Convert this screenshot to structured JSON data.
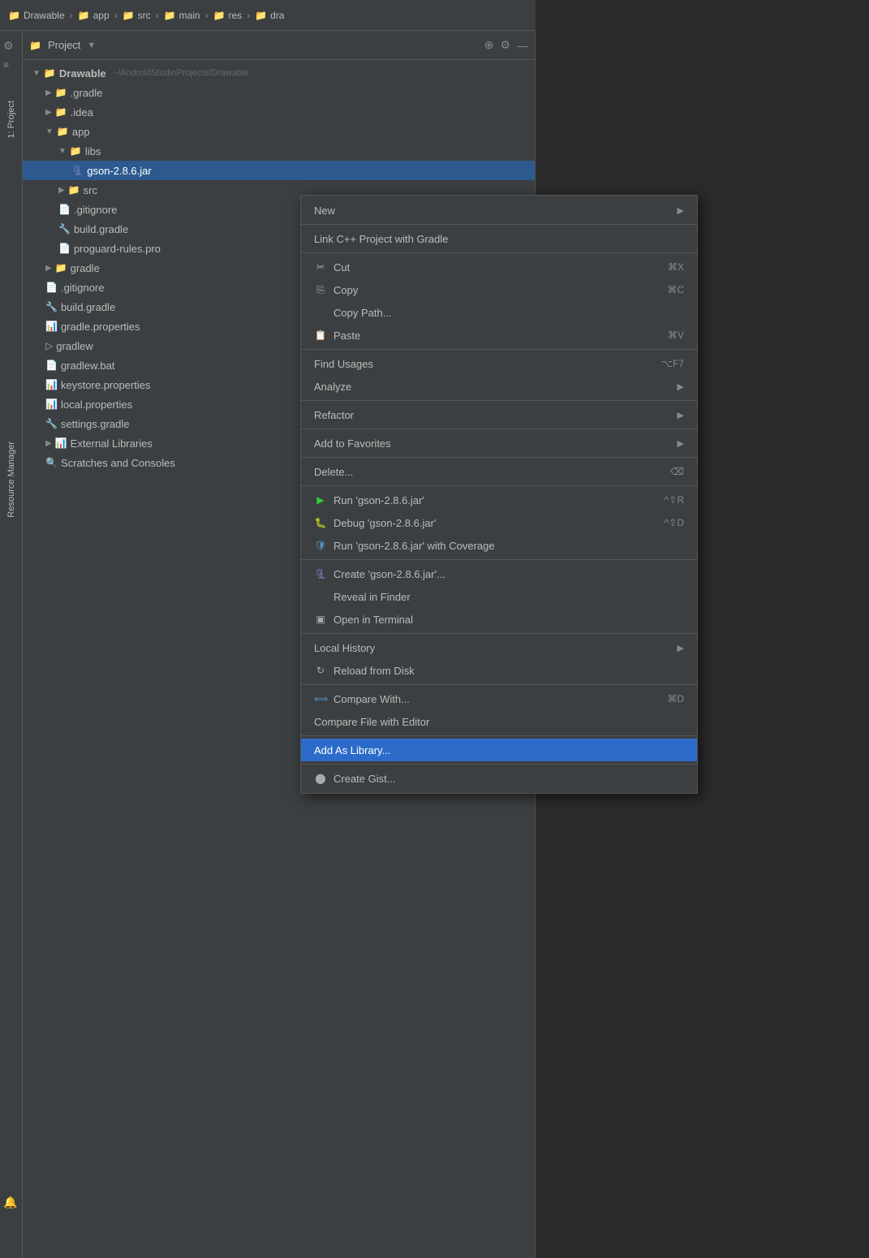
{
  "breadcrumb": {
    "items": [
      "Drawable",
      "app",
      "src",
      "main",
      "res",
      "dra"
    ]
  },
  "panel": {
    "title": "Project",
    "project_root": "Drawable",
    "project_path": "~/AndroidStudioProjects/Drawable",
    "tree": [
      {
        "label": ".gradle",
        "indent": 1,
        "type": "folder",
        "expanded": false
      },
      {
        "label": ".idea",
        "indent": 1,
        "type": "folder",
        "expanded": false
      },
      {
        "label": "app",
        "indent": 1,
        "type": "folder",
        "expanded": true
      },
      {
        "label": "libs",
        "indent": 2,
        "type": "folder",
        "expanded": true
      },
      {
        "label": "gson-2.8.6.jar",
        "indent": 3,
        "type": "jar",
        "selected": true
      },
      {
        "label": "src",
        "indent": 2,
        "type": "folder",
        "expanded": false
      },
      {
        "label": ".gitignore",
        "indent": 2,
        "type": "file"
      },
      {
        "label": "build.gradle",
        "indent": 2,
        "type": "gradle"
      },
      {
        "label": "proguard-rules.pro",
        "indent": 2,
        "type": "file"
      },
      {
        "label": "gradle",
        "indent": 1,
        "type": "folder",
        "expanded": false
      },
      {
        "label": ".gitignore",
        "indent": 1,
        "type": "file"
      },
      {
        "label": "build.gradle",
        "indent": 1,
        "type": "gradle"
      },
      {
        "label": "gradle.properties",
        "indent": 1,
        "type": "properties"
      },
      {
        "label": "gradlew",
        "indent": 1,
        "type": "file"
      },
      {
        "label": "gradlew.bat",
        "indent": 1,
        "type": "file"
      },
      {
        "label": "keystore.properties",
        "indent": 1,
        "type": "properties"
      },
      {
        "label": "local.properties",
        "indent": 1,
        "type": "properties"
      },
      {
        "label": "settings.gradle",
        "indent": 1,
        "type": "gradle"
      },
      {
        "label": "External Libraries",
        "indent": 1,
        "type": "folder",
        "expanded": false
      },
      {
        "label": "Scratches and Consoles",
        "indent": 1,
        "type": "scratches"
      }
    ]
  },
  "context_menu": {
    "items": [
      {
        "id": "new",
        "label": "New",
        "has_arrow": true,
        "type": "normal"
      },
      {
        "id": "sep1",
        "type": "separator"
      },
      {
        "id": "link-cpp",
        "label": "Link C++ Project with Gradle",
        "type": "normal"
      },
      {
        "id": "sep2",
        "type": "separator"
      },
      {
        "id": "cut",
        "label": "Cut",
        "shortcut": "⌘X",
        "icon": "✂",
        "type": "normal"
      },
      {
        "id": "copy",
        "label": "Copy",
        "shortcut": "⌘C",
        "icon": "⎘",
        "type": "normal"
      },
      {
        "id": "copy-path",
        "label": "Copy Path...",
        "type": "normal"
      },
      {
        "id": "paste",
        "label": "Paste",
        "shortcut": "⌘V",
        "icon": "📋",
        "type": "normal"
      },
      {
        "id": "sep3",
        "type": "separator"
      },
      {
        "id": "find-usages",
        "label": "Find Usages",
        "shortcut": "⌥F7",
        "type": "normal"
      },
      {
        "id": "analyze",
        "label": "Analyze",
        "has_arrow": true,
        "type": "normal"
      },
      {
        "id": "sep4",
        "type": "separator"
      },
      {
        "id": "refactor",
        "label": "Refactor",
        "has_arrow": true,
        "type": "normal"
      },
      {
        "id": "sep5",
        "type": "separator"
      },
      {
        "id": "add-favorites",
        "label": "Add to Favorites",
        "has_arrow": true,
        "type": "normal"
      },
      {
        "id": "sep6",
        "type": "separator"
      },
      {
        "id": "delete",
        "label": "Delete...",
        "shortcut": "⌫",
        "type": "normal"
      },
      {
        "id": "sep7",
        "type": "separator"
      },
      {
        "id": "run",
        "label": "Run 'gson-2.8.6.jar'",
        "shortcut": "^⇧R",
        "icon_type": "run",
        "type": "normal"
      },
      {
        "id": "debug",
        "label": "Debug 'gson-2.8.6.jar'",
        "shortcut": "^⇧D",
        "icon_type": "debug",
        "type": "normal"
      },
      {
        "id": "coverage",
        "label": "Run 'gson-2.8.6.jar' with Coverage",
        "icon_type": "coverage",
        "type": "normal"
      },
      {
        "id": "sep8",
        "type": "separator"
      },
      {
        "id": "create",
        "label": "Create 'gson-2.8.6.jar'...",
        "icon_type": "create",
        "type": "normal"
      },
      {
        "id": "reveal",
        "label": "Reveal in Finder",
        "type": "normal"
      },
      {
        "id": "terminal",
        "label": "Open in Terminal",
        "icon_type": "terminal",
        "type": "normal"
      },
      {
        "id": "sep9",
        "type": "separator"
      },
      {
        "id": "local-history",
        "label": "Local History",
        "has_arrow": true,
        "type": "normal"
      },
      {
        "id": "reload",
        "label": "Reload from Disk",
        "icon_type": "reload",
        "type": "normal"
      },
      {
        "id": "sep10",
        "type": "separator"
      },
      {
        "id": "compare-with",
        "label": "Compare With...",
        "shortcut": "⌘D",
        "icon_type": "compare",
        "type": "normal"
      },
      {
        "id": "compare-editor",
        "label": "Compare File with Editor",
        "type": "normal"
      },
      {
        "id": "sep11",
        "type": "separator"
      },
      {
        "id": "add-library",
        "label": "Add As Library...",
        "type": "highlighted"
      },
      {
        "id": "sep12",
        "type": "separator"
      },
      {
        "id": "create-gist",
        "label": "Create Gist...",
        "icon_type": "github",
        "type": "normal"
      }
    ]
  },
  "side": {
    "project_label": "1: Project",
    "resource_label": "Resource Manager"
  }
}
